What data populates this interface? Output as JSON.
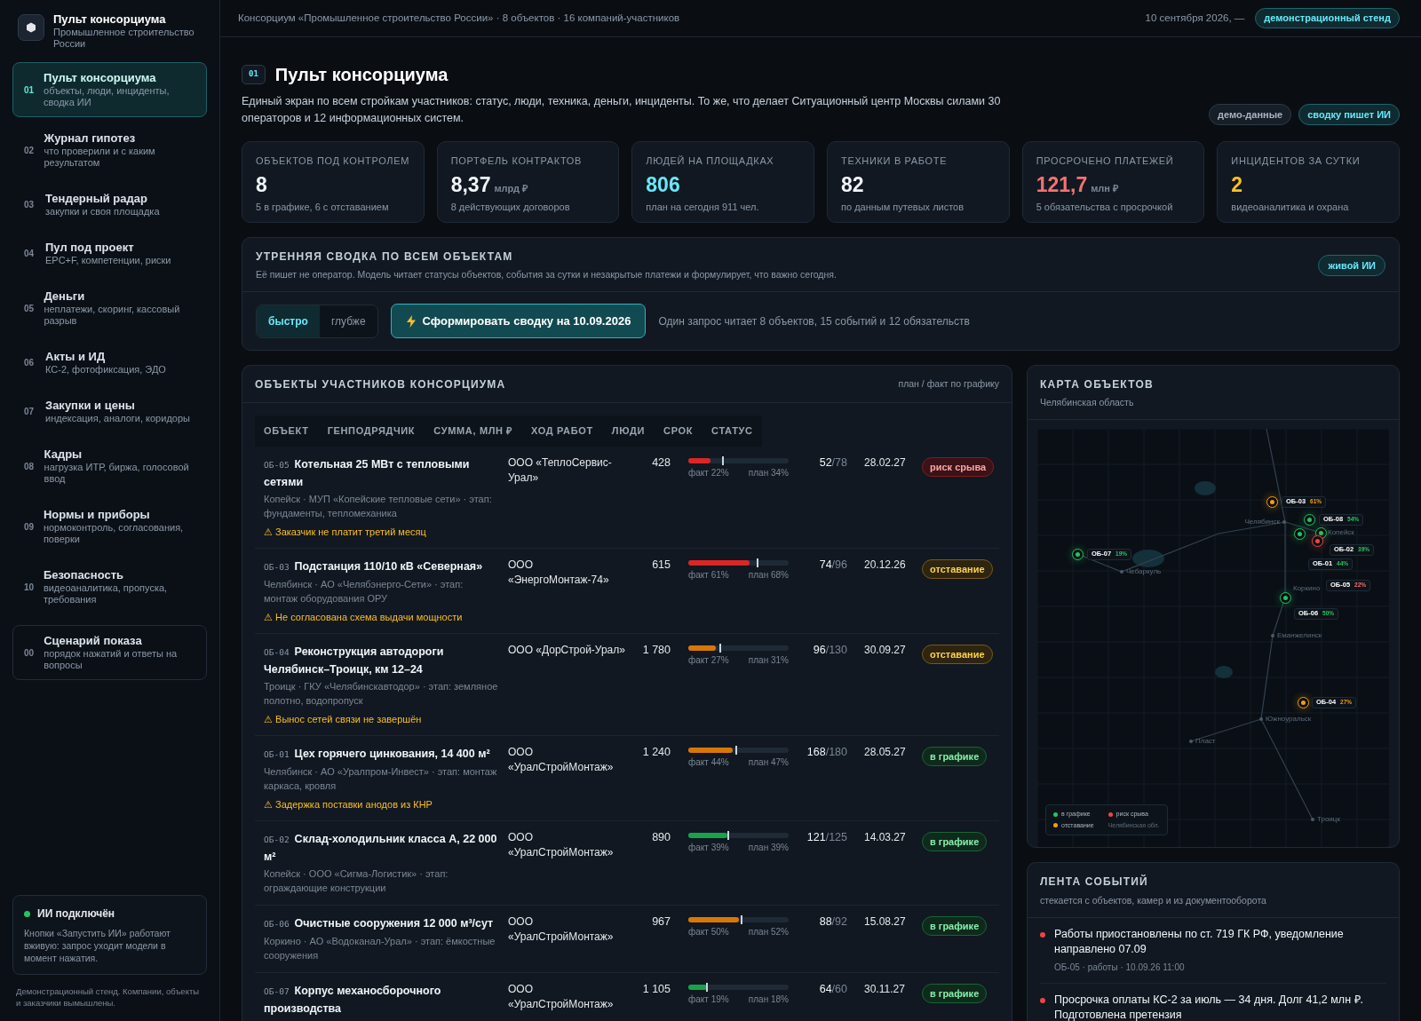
{
  "brand": {
    "title": "Пульт консорциума",
    "subtitle": "Промышленное строительство России"
  },
  "nav": [
    {
      "num": "01",
      "title": "Пульт консорциума",
      "sub": "объекты, люди, инциденты, сводка ИИ",
      "selected": true,
      "kind": "page"
    },
    {
      "num": "02",
      "title": "Журнал гипотез",
      "sub": "что проверили и с каким результатом",
      "selected": false,
      "kind": "page"
    },
    {
      "num": "03",
      "title": "Тендерный радар",
      "sub": "закупки и своя площадка",
      "selected": false,
      "kind": "page"
    },
    {
      "num": "04",
      "title": "Пул под проект",
      "sub": "EPC+F, компетенции, риски",
      "selected": false,
      "kind": "page"
    },
    {
      "num": "05",
      "title": "Деньги",
      "sub": "неплатежи, скоринг, кассовый разрыв",
      "selected": false,
      "kind": "page"
    },
    {
      "num": "06",
      "title": "Акты и ИД",
      "sub": "КС-2, фотофиксация, ЭДО",
      "selected": false,
      "kind": "page"
    },
    {
      "num": "07",
      "title": "Закупки и цены",
      "sub": "индексация, аналоги, коридоры",
      "selected": false,
      "kind": "page"
    },
    {
      "num": "08",
      "title": "Кадры",
      "sub": "нагрузка ИТР, биржа, голосовой ввод",
      "selected": false,
      "kind": "page"
    },
    {
      "num": "09",
      "title": "Нормы и приборы",
      "sub": "нормоконтроль, согласования, поверки",
      "selected": false,
      "kind": "page"
    },
    {
      "num": "10",
      "title": "Безопасность",
      "sub": "видеоаналитика, пропуска, требования",
      "selected": false,
      "kind": "page"
    },
    {
      "num": "00",
      "title": "Сценарий показа",
      "sub": "порядок нажатий и ответы на вопросы",
      "selected": false,
      "kind": "scenario"
    }
  ],
  "ai_status": {
    "title": "ИИ подключён",
    "on": true,
    "text": "Кнопки «Запустить ИИ» работают вживую: запрос уходит модели в момент нажатия."
  },
  "sidebar_footer": "Демонстрационный стенд. Компании, объекты и заказчики вымышлены.",
  "topbar": {
    "breadcrumb": "Консорциум «Промышленное строительство России» · 8 объектов · 16 компаний-участников",
    "date": "10 сентября 2026, —",
    "badge": "демонстрационный стенд"
  },
  "page": {
    "code": "01",
    "title": "Пульт консорциума",
    "description": "Единый экран по всем стройкам участников: статус, люди, техника, деньги, инциденты. То же, что делает Ситуационный центр Москвы силами 30 операторов и 12 информационных систем.",
    "badges": [
      {
        "label": "демо-данные",
        "kind": "neutral"
      },
      {
        "label": "сводку пишет ИИ",
        "kind": "accent"
      }
    ]
  },
  "kpis": [
    {
      "label": "ОБЪЕКТОВ ПОД КОНТРОЛЕМ",
      "value": "8",
      "sub": "5 в графике, 6 с отставанием",
      "color": "#f1f5f9"
    },
    {
      "label": "ПОРТФЕЛЬ КОНТРАКТОВ",
      "value": "8,37",
      "unit": "млрд ₽",
      "sub": "8 действующих договоров",
      "color": "#f1f5f9"
    },
    {
      "label": "ЛЮДЕЙ НА ПЛОЩАДКАХ",
      "value": "806",
      "sub": "план на сегодня 911 чел.",
      "color": "#67e8f9"
    },
    {
      "label": "ТЕХНИКИ В РАБОТЕ",
      "value": "82",
      "sub": "по данным путевых листов",
      "color": "#f1f5f9"
    },
    {
      "label": "ПРОСРОЧЕНО ПЛАТЕЖЕЙ",
      "value": "121,7",
      "unit": "млн ₽",
      "sub": "5 обязательства с просрочкой",
      "color": "#f87171"
    },
    {
      "label": "ИНЦИДЕНТОВ ЗА СУТКИ",
      "value": "2",
      "sub": "видеоаналитика и охрана",
      "color": "#fbbf24"
    }
  ],
  "summary": {
    "title": "УТРЕННЯЯ СВОДКА ПО ВСЕМ ОБЪЕКТАМ",
    "subtitle": "Её пишет не оператор. Модель читает статусы объектов, события за сутки и незакрытые платежи и формулирует, что важно сегодня.",
    "badge": "живой ИИ",
    "modes": [
      {
        "label": "быстро",
        "selected": true
      },
      {
        "label": "глубже",
        "selected": false
      }
    ],
    "button": "Сформировать сводку на 10.09.2026",
    "note": "Один запрос читает 8 объектов, 15 событий и 12 обязательств"
  },
  "table": {
    "title": "ОБЪЕКТЫ УЧАСТНИКОВ КОНСОРЦИУМА",
    "legend": "план / факт по графику",
    "columns": [
      "ОБЪЕКТ",
      "ГЕНПОДРЯДЧИК",
      "СУММА, МЛН ₽",
      "ХОД РАБОТ",
      "ЛЮДИ",
      "СРОК",
      "СТАТУС"
    ],
    "rows": [
      {
        "code": "ОБ-05",
        "name": "Котельная 25 МВт с тепловыми сетями",
        "details": "Копейск · МУП «Копейские тепловые сети» · этап: фундаменты, тепломеханика",
        "warning": "⚠ Заказчик не платит третий месяц",
        "contractor": "ООО «ТеплоСервис-Урал»",
        "sum": "428",
        "progress": {
          "color": "#dc2626",
          "fact": {
            "level": 0.22,
            "label": "факт 22%"
          },
          "plan": {
            "level": 0.34,
            "label": "план 34%"
          }
        },
        "people": {
          "fact": "52",
          "plan": "/78"
        },
        "deadline": "28.02.27",
        "status": {
          "label": "риск срыва",
          "kind": "risk"
        }
      },
      {
        "code": "ОБ-03",
        "name": "Подстанция 110/10 кВ «Северная»",
        "details": "Челябинск · АО «Челябэнерго-Сети» · этап: монтаж оборудования ОРУ",
        "warning": "⚠ Не согласована схема выдачи мощности",
        "contractor": "ООО «ЭнергоМонтаж-74»",
        "sum": "615",
        "progress": {
          "color": "#dc2626",
          "fact": {
            "level": 0.61,
            "label": "факт 61%"
          },
          "plan": {
            "level": 0.68,
            "label": "план 68%"
          }
        },
        "people": {
          "fact": "74",
          "plan": "/96"
        },
        "deadline": "20.12.26",
        "status": {
          "label": "отставание",
          "kind": "lag"
        }
      },
      {
        "code": "ОБ-04",
        "name": "Реконструкция автодороги Челябинск–Троицк, км 12–24",
        "details": "Троицк · ГКУ «Челябинскавтодор» · этап: земляное полотно, водопропуск",
        "warning": "⚠ Вынос сетей связи не завершён",
        "contractor": "ООО «ДорСтрой-Урал»",
        "sum": "1 780",
        "progress": {
          "color": "#d97706",
          "fact": {
            "level": 0.27,
            "label": "факт 27%"
          },
          "plan": {
            "level": 0.31,
            "label": "план 31%"
          }
        },
        "people": {
          "fact": "96",
          "plan": "/130"
        },
        "deadline": "30.09.27",
        "status": {
          "label": "отставание",
          "kind": "lag"
        }
      },
      {
        "code": "ОБ-01",
        "name": "Цех горячего цинкования, 14 400 м²",
        "details": "Челябинск · АО «Уралпром-Инвест» · этап: монтаж каркаса, кровля",
        "warning": "⚠ Задержка поставки анодов из КНР",
        "contractor": "ООО «УралСтройМонтаж»",
        "sum": "1 240",
        "progress": {
          "color": "#d97706",
          "fact": {
            "level": 0.44,
            "label": "факт 44%"
          },
          "plan": {
            "level": 0.47,
            "label": "план 47%"
          }
        },
        "people": {
          "fact": "168",
          "plan": "/180"
        },
        "deadline": "28.05.27",
        "status": {
          "label": "в графике",
          "kind": "ok"
        }
      },
      {
        "code": "ОБ-02",
        "name": "Склад-холодильник класса А, 22 000 м²",
        "details": "Копейск · ООО «Сигма-Логистик» · этап: ограждающие конструкции",
        "contractor": "ООО «УралСтройМонтаж»",
        "sum": "890",
        "progress": {
          "color": "#16a34a",
          "fact": {
            "level": 0.39,
            "label": "факт 39%"
          },
          "plan": {
            "level": 0.39,
            "label": "план 39%"
          }
        },
        "people": {
          "fact": "121",
          "plan": "/125"
        },
        "deadline": "14.03.27",
        "status": {
          "label": "в графике",
          "kind": "ok"
        }
      },
      {
        "code": "ОБ-06",
        "name": "Очистные сооружения 12 000 м³/сут",
        "details": "Коркино · АО «Водоканал-Урал» · этап: ёмкостные сооружения",
        "contractor": "ООО «УралСтройМонтаж»",
        "sum": "967",
        "progress": {
          "color": "#d97706",
          "fact": {
            "level": 0.5,
            "label": "факт 50%"
          },
          "plan": {
            "level": 0.52,
            "label": "план 52%"
          }
        },
        "people": {
          "fact": "88",
          "plan": "/92"
        },
        "deadline": "15.08.27",
        "status": {
          "label": "в графике",
          "kind": "ok"
        }
      },
      {
        "code": "ОБ-07",
        "name": "Корпус механосборочного производства",
        "contractor": "ООО «УралСтройМонтаж»",
        "sum": "1 105",
        "progress": {
          "color": "#16a34a",
          "fact": {
            "level": 0.19,
            "label": "факт 19%"
          },
          "plan": {
            "level": 0.18,
            "label": "план 18%"
          }
        },
        "people": {
          "fact": "64",
          "plan": "/60"
        },
        "deadline": "30.11.27",
        "status": {
          "label": "в графике",
          "kind": "ok"
        }
      }
    ]
  },
  "map": {
    "title": "КАРТА ОБЪЕКТОВ",
    "subtitle": "Челябинская область",
    "objects": [
      {
        "code": "ОБ-03",
        "percent": "61%",
        "kind": "lag"
      },
      {
        "code": "ОБ-08",
        "percent": "54%",
        "kind": "ok"
      },
      {
        "code": "ОБ-02",
        "percent": "39%",
        "kind": "ok"
      },
      {
        "code": "ОБ-01",
        "percent": "44%",
        "kind": "ok"
      },
      {
        "code": "ОБ-05",
        "percent": "22%",
        "kind": "risk"
      },
      {
        "code": "ОБ-07",
        "percent": "19%",
        "kind": "ok"
      },
      {
        "code": "ОБ-06",
        "percent": "50%",
        "kind": "ok"
      },
      {
        "code": "ОБ-04",
        "percent": "27%",
        "kind": "lag"
      }
    ],
    "cities": [
      "Челябинск",
      "Копейск",
      "Чебаркуль",
      "Коркино",
      "Еманжелинск",
      "Южноуральск",
      "Пласт",
      "Троицк"
    ],
    "legend": [
      {
        "label": "в графике",
        "color": "#22c55e"
      },
      {
        "label": "риск срыва",
        "color": "#ef4444"
      },
      {
        "label": "отставание",
        "color": "#f59e0b"
      }
    ],
    "region": "Челябинская обл."
  },
  "events": {
    "title": "ЛЕНТА СОБЫТИЙ",
    "subtitle": "стекается с объектов, камер и из документооборота",
    "items": [
      {
        "text": "Работы приостановлены по ст. 719 ГК РФ, уведомление направлено 07.09",
        "meta": "ОБ-05 · работы · 10.09.26 11:00",
        "color": "#ef4444"
      },
      {
        "text": "Просрочка оплаты КС-2 за июль — 34 дня. Долг 41,2 млн ₽. Подготовлена претензия",
        "color": "#ef4444"
      }
    ]
  }
}
